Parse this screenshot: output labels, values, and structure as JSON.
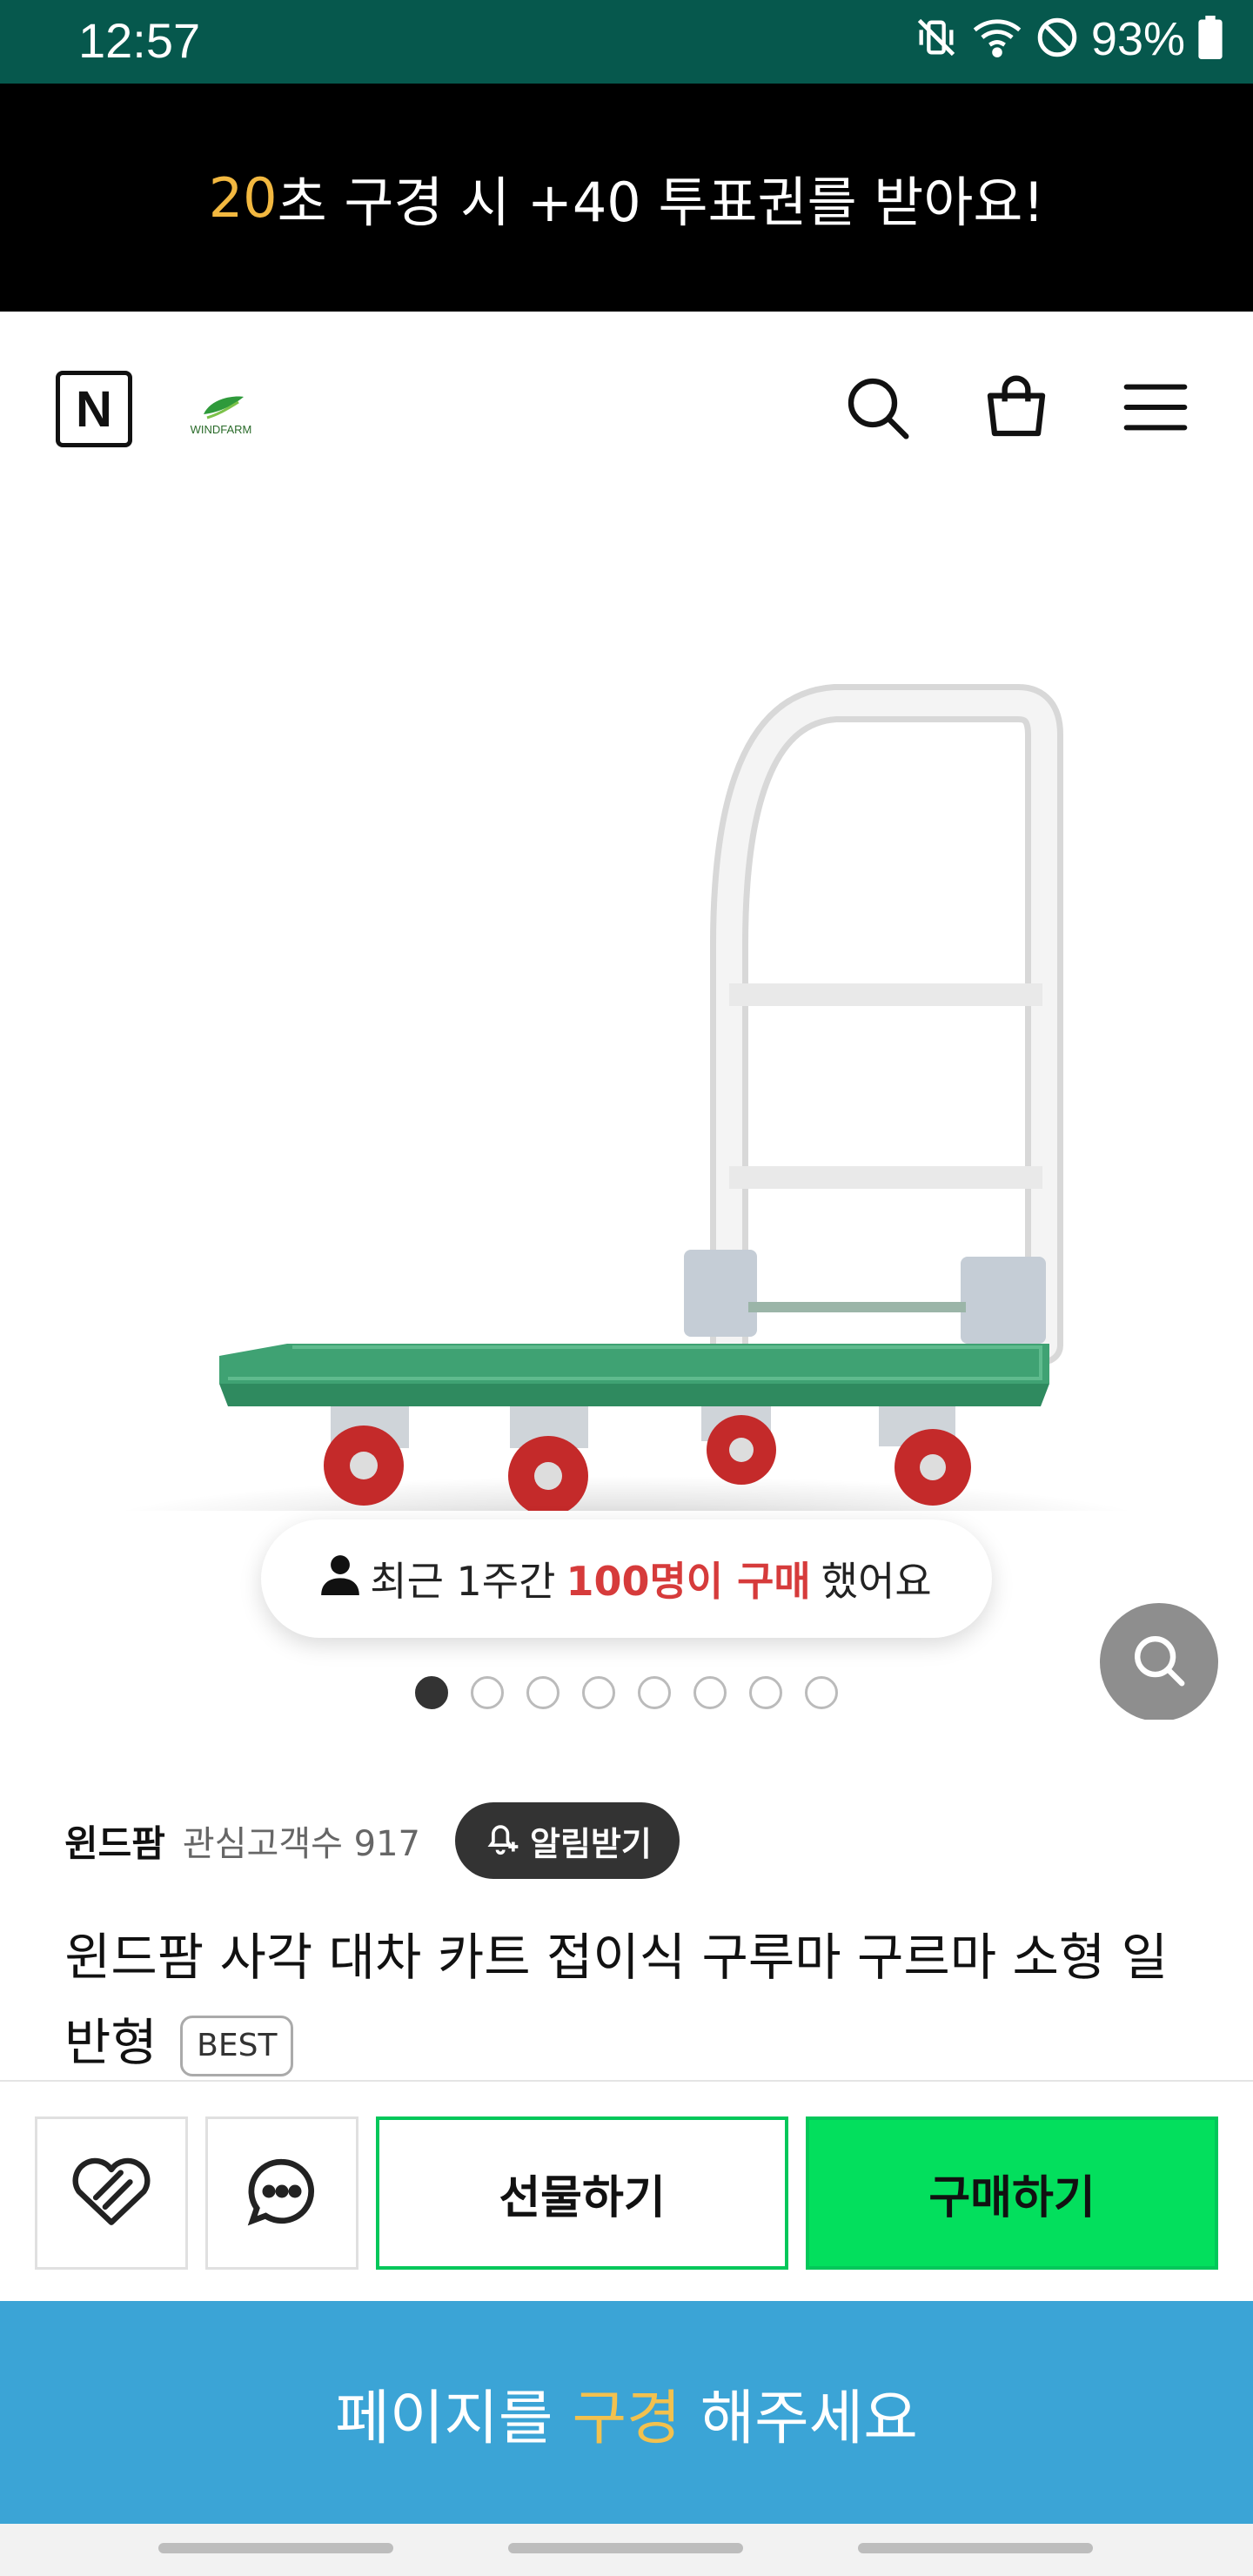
{
  "status_bar": {
    "time": "12:57",
    "battery": "93%",
    "icons": [
      "vibrate-icon",
      "wifi-icon",
      "do-not-disturb-icon",
      "battery-icon"
    ]
  },
  "promo": {
    "seconds": "20",
    "text": "초 구경 시 +40 투표권를 받아요!"
  },
  "header": {
    "naver_logo": "N",
    "brand_logo_text": "WINDFARM",
    "icons": [
      "search-icon",
      "cart-icon",
      "menu-icon"
    ]
  },
  "product_image": {
    "recent": {
      "prefix": "최근 1주간",
      "highlight": "100명이 구매",
      "suffix": "했어요"
    },
    "carousel": {
      "total": 8,
      "active": 1
    }
  },
  "store": {
    "name": "윈드팜",
    "follower_label": "관심고객수 917",
    "notify_label": "알림받기"
  },
  "product": {
    "title": "윈드팜 사각 대차 카트 접이식 구루마 구르마 소형 일반형",
    "badge": "BEST"
  },
  "actions": {
    "gift_label": "선물하기",
    "buy_label": "구매하기"
  },
  "browse_banner": {
    "before": "페이지를",
    "highlight": "구경",
    "after": "해주세요"
  },
  "colors": {
    "status_bar": "#06584d",
    "promo_accent": "#f2b840",
    "naver_green": "#03c75a",
    "buy_green": "#03df5d",
    "browse_blue": "#3ba4d6",
    "highlight_red": "#d63b3b"
  }
}
